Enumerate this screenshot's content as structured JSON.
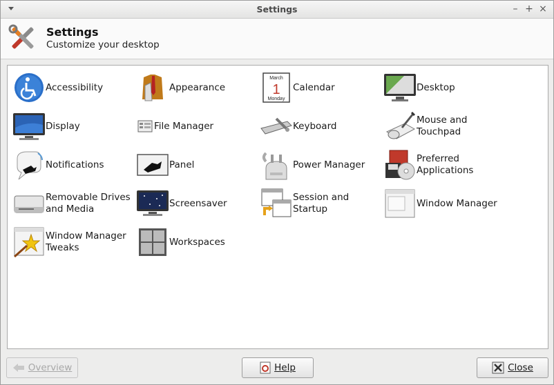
{
  "window": {
    "title": "Settings"
  },
  "header": {
    "title": "Settings",
    "subtitle": "Customize your desktop"
  },
  "items": [
    {
      "label": "Accessibility",
      "icon": "accessibility-icon"
    },
    {
      "label": "Appearance",
      "icon": "appearance-icon"
    },
    {
      "label": "Calendar",
      "icon": "calendar-icon",
      "cal_month": "March",
      "cal_day": "1",
      "cal_weekday": "Monday"
    },
    {
      "label": "Desktop",
      "icon": "desktop-icon"
    },
    {
      "label": "Display",
      "icon": "display-icon"
    },
    {
      "label": "File Manager",
      "icon": "file-manager-icon"
    },
    {
      "label": "Keyboard",
      "icon": "keyboard-icon"
    },
    {
      "label": "Mouse and Touchpad",
      "icon": "mouse-touchpad-icon"
    },
    {
      "label": "Notifications",
      "icon": "notifications-icon"
    },
    {
      "label": "Panel",
      "icon": "panel-icon"
    },
    {
      "label": "Power Manager",
      "icon": "power-manager-icon"
    },
    {
      "label": "Preferred Applications",
      "icon": "preferred-applications-icon"
    },
    {
      "label": "Removable Drives and Media",
      "icon": "removable-drives-icon"
    },
    {
      "label": "Screensaver",
      "icon": "screensaver-icon"
    },
    {
      "label": "Session and Startup",
      "icon": "session-startup-icon"
    },
    {
      "label": "Window Manager",
      "icon": "window-manager-icon"
    },
    {
      "label": "Window Manager Tweaks",
      "icon": "window-manager-tweaks-icon"
    },
    {
      "label": "Workspaces",
      "icon": "workspaces-icon"
    }
  ],
  "footer": {
    "overview_label": "Overview",
    "help_label": "Help",
    "close_label": "Close"
  }
}
